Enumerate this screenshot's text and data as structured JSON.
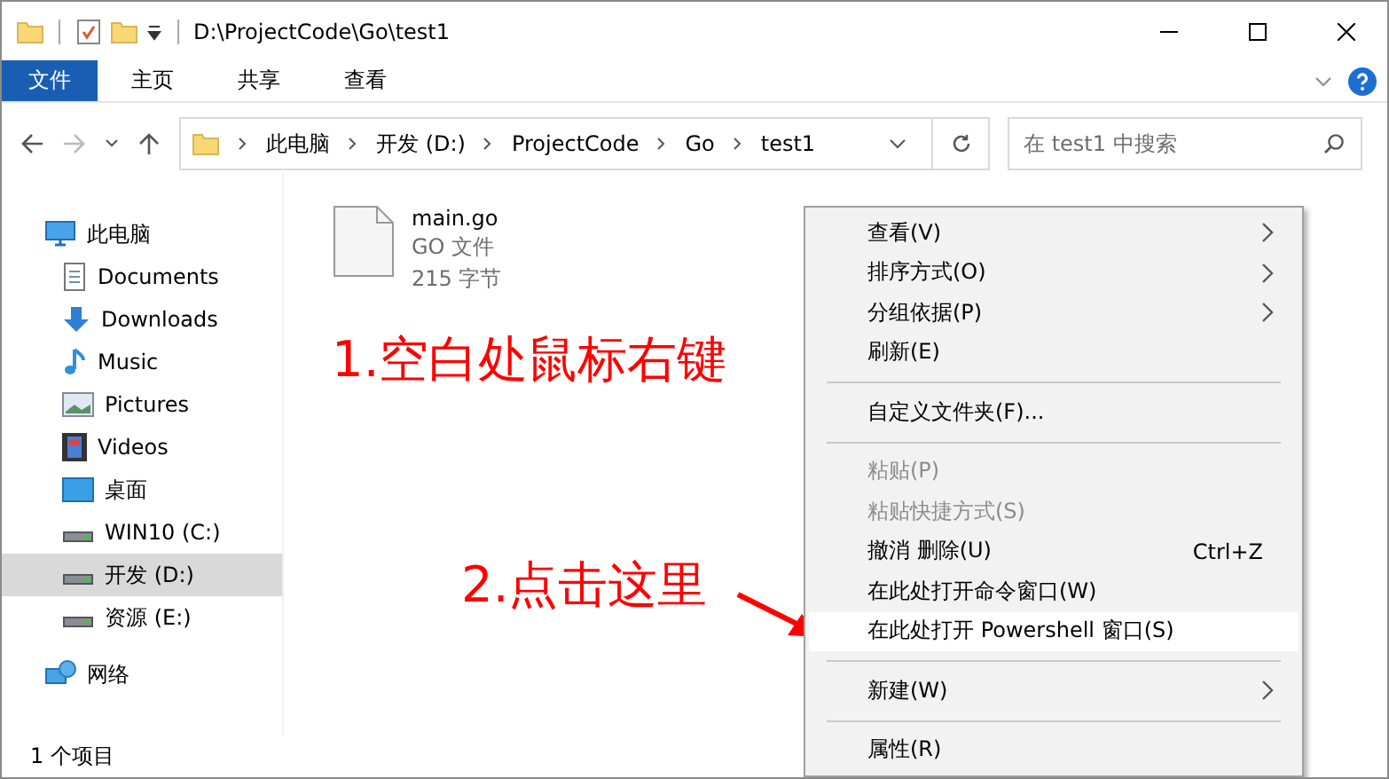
{
  "window": {
    "title": "D:\\ProjectCode\\Go\\test1"
  },
  "ribbon_tabs": [
    {
      "label": "文件",
      "selected": true
    },
    {
      "label": "主页",
      "selected": false
    },
    {
      "label": "共享",
      "selected": false
    },
    {
      "label": "查看",
      "selected": false
    }
  ],
  "breadcrumb": [
    "此电脑",
    "开发 (D:)",
    "ProjectCode",
    "Go",
    "test1"
  ],
  "search": {
    "placeholder": "在 test1 中搜索"
  },
  "sidebar": {
    "items": [
      {
        "label": "此电脑",
        "kind": "pc",
        "selected": false,
        "children": [
          {
            "label": "Documents",
            "kind": "documents",
            "selected": false
          },
          {
            "label": "Downloads",
            "kind": "downloads",
            "selected": false
          },
          {
            "label": "Music",
            "kind": "music",
            "selected": false
          },
          {
            "label": "Pictures",
            "kind": "pictures",
            "selected": false
          },
          {
            "label": "Videos",
            "kind": "videos",
            "selected": false
          },
          {
            "label": "桌面",
            "kind": "desktop",
            "selected": false
          },
          {
            "label": "WIN10 (C:)",
            "kind": "drive",
            "selected": false
          },
          {
            "label": "开发 (D:)",
            "kind": "drive",
            "selected": true
          },
          {
            "label": "资源 (E:)",
            "kind": "drive",
            "selected": false
          }
        ]
      },
      {
        "label": "网络",
        "kind": "network",
        "selected": false
      }
    ]
  },
  "files": [
    {
      "name": "main.go",
      "type": "GO 文件",
      "size": "215 字节"
    }
  ],
  "annotations": [
    {
      "text": "1.空白处鼠标右键"
    },
    {
      "text": "2.点击这里"
    }
  ],
  "context_menu": [
    {
      "kind": "item",
      "label": "查看(V)",
      "submenu": true,
      "disabled": false,
      "selected": false
    },
    {
      "kind": "item",
      "label": "排序方式(O)",
      "submenu": true,
      "disabled": false,
      "selected": false
    },
    {
      "kind": "item",
      "label": "分组依据(P)",
      "submenu": true,
      "disabled": false,
      "selected": false
    },
    {
      "kind": "item",
      "label": "刷新(E)",
      "submenu": false,
      "disabled": false,
      "selected": false
    },
    {
      "kind": "separator"
    },
    {
      "kind": "item",
      "label": "自定义文件夹(F)...",
      "submenu": false,
      "disabled": false,
      "selected": false
    },
    {
      "kind": "separator"
    },
    {
      "kind": "item",
      "label": "粘贴(P)",
      "submenu": false,
      "disabled": true,
      "selected": false
    },
    {
      "kind": "item",
      "label": "粘贴快捷方式(S)",
      "submenu": false,
      "disabled": true,
      "selected": false
    },
    {
      "kind": "item",
      "label": "撤消 删除(U)",
      "shortcut": "Ctrl+Z",
      "submenu": false,
      "disabled": false,
      "selected": false
    },
    {
      "kind": "item",
      "label": "在此处打开命令窗口(W)",
      "submenu": false,
      "disabled": false,
      "selected": false
    },
    {
      "kind": "item",
      "label": "在此处打开 Powershell 窗口(S)",
      "submenu": false,
      "disabled": false,
      "selected": true
    },
    {
      "kind": "separator"
    },
    {
      "kind": "item",
      "label": "新建(W)",
      "submenu": true,
      "disabled": false,
      "selected": false
    },
    {
      "kind": "separator"
    },
    {
      "kind": "item",
      "label": "属性(R)",
      "submenu": false,
      "disabled": false,
      "selected": false
    }
  ],
  "status_bar": {
    "text": "1 个项目"
  }
}
